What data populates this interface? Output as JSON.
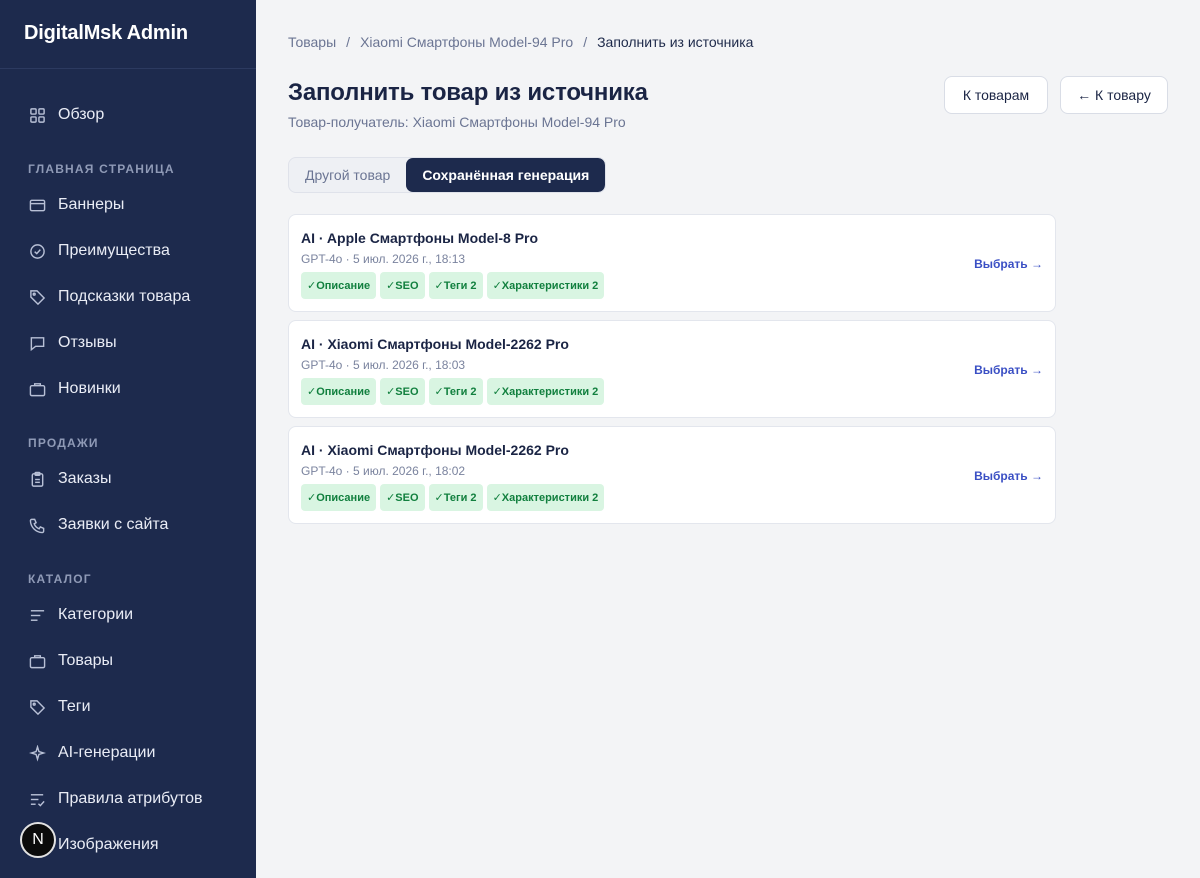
{
  "app": {
    "title": "DigitalMsk Admin",
    "avatar_letter": "N"
  },
  "sidebar": {
    "top": [
      {
        "label": "Обзор",
        "icon": "grid-icon"
      }
    ],
    "sections": [
      {
        "title": "Главная страница",
        "items": [
          {
            "label": "Баннеры",
            "icon": "card-icon"
          },
          {
            "label": "Преимущества",
            "icon": "check-circle-icon"
          },
          {
            "label": "Подсказки товара",
            "icon": "tag-icon"
          },
          {
            "label": "Отзывы",
            "icon": "chat-icon"
          },
          {
            "label": "Новинки",
            "icon": "briefcase-icon"
          }
        ]
      },
      {
        "title": "Продажи",
        "items": [
          {
            "label": "Заказы",
            "icon": "clipboard-icon"
          },
          {
            "label": "Заявки с сайта",
            "icon": "phone-icon"
          }
        ]
      },
      {
        "title": "Каталог",
        "items": [
          {
            "label": "Категории",
            "icon": "lines-icon"
          },
          {
            "label": "Товары",
            "icon": "briefcase-icon"
          },
          {
            "label": "Теги",
            "icon": "tag-icon"
          },
          {
            "label": "AI-генерации",
            "icon": "sparkle-icon"
          },
          {
            "label": "Правила атрибутов",
            "icon": "list-check-icon"
          },
          {
            "label": "Изображения",
            "icon": "image-icon"
          }
        ]
      }
    ]
  },
  "breadcrumb": {
    "items": [
      "Товары",
      "Xiaomi Смартфоны Model-94 Pro"
    ],
    "current": "Заполнить из источника",
    "separator": "/"
  },
  "header": {
    "title": "Заполнить товар из источника",
    "subtitle": "Товар-получатель: Xiaomi Смартфоны Model-94 Pro",
    "btn_products": "К товарам",
    "btn_product": "← К товару"
  },
  "tabs": [
    {
      "label": "Другой товар",
      "active": false
    },
    {
      "label": "Сохранённая генерация",
      "active": true
    }
  ],
  "generations": [
    {
      "title": "AI · Apple Смартфоны Model-8 Pro",
      "meta": "GPT-4o · 5 июл. 2026 г., 18:13",
      "chips": [
        "✓Описание",
        "✓SEO",
        "✓Теги 2",
        "✓Характеристики 2"
      ],
      "action": "Выбрать →"
    },
    {
      "title": "AI · Xiaomi Смартфоны Model-2262 Pro",
      "meta": "GPT-4o · 5 июл. 2026 г., 18:03",
      "chips": [
        "✓Описание",
        "✓SEO",
        "✓Теги 2",
        "✓Характеристики 2"
      ],
      "action": "Выбрать →"
    },
    {
      "title": "AI · Xiaomi Смартфоны Model-2262 Pro",
      "meta": "GPT-4o · 5 июл. 2026 г., 18:02",
      "chips": [
        "✓Описание",
        "✓SEO",
        "✓Теги 2",
        "✓Характеристики 2"
      ],
      "action": "Выбрать →"
    }
  ]
}
